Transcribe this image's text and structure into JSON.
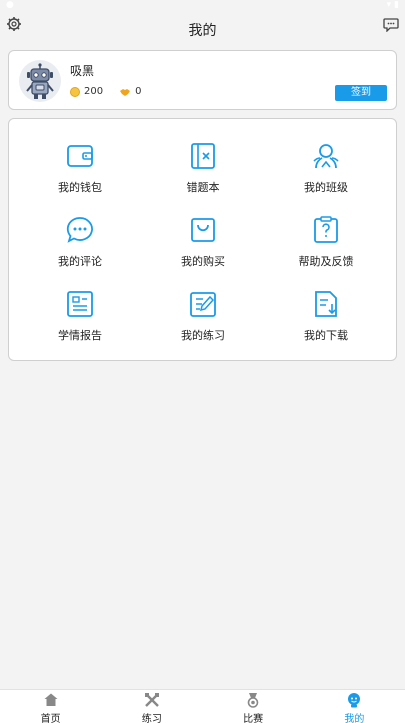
{
  "header": {
    "title": "我的"
  },
  "profile": {
    "name": "吸黑",
    "coins": "200",
    "likes": "0",
    "checkin_label": "签到"
  },
  "menu": {
    "items": [
      {
        "label": "我的钱包",
        "icon": "wallet-icon"
      },
      {
        "label": "错题本",
        "icon": "wrong-book-icon"
      },
      {
        "label": "我的班级",
        "icon": "class-icon"
      },
      {
        "label": "我的评论",
        "icon": "comment-icon"
      },
      {
        "label": "我的购买",
        "icon": "purchase-bag-icon"
      },
      {
        "label": "帮助及反馈",
        "icon": "help-icon"
      },
      {
        "label": "学情报告",
        "icon": "report-icon"
      },
      {
        "label": "我的练习",
        "icon": "practice-icon"
      },
      {
        "label": "我的下载",
        "icon": "download-icon"
      }
    ]
  },
  "nav": {
    "items": [
      {
        "label": "首页",
        "icon": "home-icon"
      },
      {
        "label": "练习",
        "icon": "practice-nav-icon"
      },
      {
        "label": "比赛",
        "icon": "medal-icon"
      },
      {
        "label": "我的",
        "icon": "profile-icon"
      }
    ],
    "active_index": 3
  },
  "colors": {
    "accent": "#1a9be9",
    "background": "#f3f3f3"
  }
}
